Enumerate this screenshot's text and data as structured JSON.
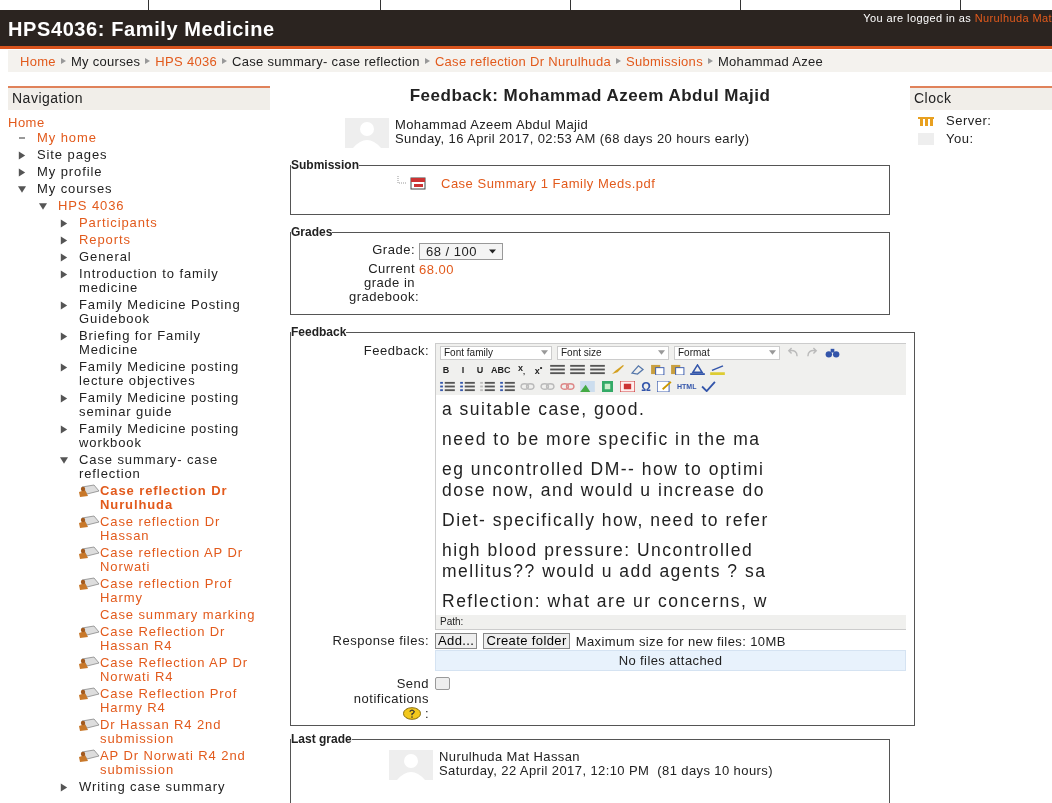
{
  "header": {
    "title": "HPS4036: Family Medicine",
    "login_text": "You are logged in as",
    "login_user": "Nurulhuda Mat"
  },
  "breadcrumb": [
    {
      "label": "Home",
      "link": true
    },
    {
      "label": "My courses",
      "link": false
    },
    {
      "label": "HPS 4036",
      "link": true
    },
    {
      "label": "Case summary- case reflection",
      "link": false
    },
    {
      "label": "Case reflection Dr Nurulhuda",
      "link": true
    },
    {
      "label": "Submissions",
      "link": true
    },
    {
      "label": "Mohammad Azee",
      "link": false
    }
  ],
  "navigation": {
    "title": "Navigation",
    "home": "Home",
    "items": [
      {
        "label": "My home",
        "kind": "home",
        "link": true
      },
      {
        "label": "Site pages",
        "kind": "branch",
        "expanded": false,
        "link": false
      },
      {
        "label": "My profile",
        "kind": "branch",
        "expanded": false,
        "link": false
      },
      {
        "label": "My courses",
        "kind": "branch",
        "expanded": true,
        "link": false,
        "children": [
          {
            "label": "HPS 4036",
            "kind": "branch",
            "expanded": true,
            "link": true,
            "children": [
              {
                "label": "Participants",
                "kind": "branch",
                "expanded": false,
                "link": true
              },
              {
                "label": "Reports",
                "kind": "branch",
                "expanded": false,
                "link": true
              },
              {
                "label": "General",
                "kind": "branch",
                "expanded": false,
                "link": false
              },
              {
                "label": "Introduction to family medicine",
                "kind": "branch",
                "expanded": false,
                "link": false
              },
              {
                "label": "Family Medicine Posting Guidebook",
                "kind": "branch",
                "expanded": false,
                "link": false
              },
              {
                "label": "Briefing for Family Medicine",
                "kind": "branch",
                "expanded": false,
                "link": false
              },
              {
                "label": "Family Medicine posting lecture objectives",
                "kind": "branch",
                "expanded": false,
                "link": false
              },
              {
                "label": "Family Medicine posting seminar guide",
                "kind": "branch",
                "expanded": false,
                "link": false
              },
              {
                "label": "Family Medicine posting workbook",
                "kind": "branch",
                "expanded": false,
                "link": false
              },
              {
                "label": "Case summary- case reflection",
                "kind": "branch",
                "expanded": true,
                "link": false,
                "children": [
                  {
                    "label": "Case reflection Dr Nurulhuda",
                    "kind": "activity",
                    "link": true,
                    "selected": true
                  },
                  {
                    "label": "Case reflection Dr Hassan",
                    "kind": "activity",
                    "link": true,
                    "selected": false
                  },
                  {
                    "label": "Case reflection AP Dr Norwati",
                    "kind": "activity",
                    "link": true,
                    "selected": false
                  },
                  {
                    "label": "Case reflection Prof Harmy",
                    "kind": "activity",
                    "link": true,
                    "selected": false
                  },
                  {
                    "label": "Case summary marking",
                    "kind": "plain",
                    "link": true,
                    "selected": false
                  },
                  {
                    "label": "Case Reflection Dr Hassan R4",
                    "kind": "activity",
                    "link": true,
                    "selected": false
                  },
                  {
                    "label": "Case Reflection AP Dr Norwati R4",
                    "kind": "activity",
                    "link": true,
                    "selected": false
                  },
                  {
                    "label": "Case Reflection Prof Harmy R4",
                    "kind": "activity",
                    "link": true,
                    "selected": false
                  },
                  {
                    "label": "Dr Hassan R4 2nd submission",
                    "kind": "activity",
                    "link": true,
                    "selected": false
                  },
                  {
                    "label": "AP Dr Norwati R4 2nd submission",
                    "kind": "activity",
                    "link": true,
                    "selected": false
                  }
                ]
              },
              {
                "label": "Writing case summary",
                "kind": "branch",
                "expanded": false,
                "link": false
              }
            ]
          }
        ]
      }
    ]
  },
  "main": {
    "title": "Feedback: Mohammad Azeem Abdul Majid",
    "author": {
      "name": "Mohammad Azeem Abdul Majid",
      "date": "Sunday, 16 April 2017, 02:53 AM (68 days 20 hours early)"
    },
    "submission": {
      "legend": "Submission",
      "file": "Case Summary 1 Family Meds.pdf"
    },
    "grades": {
      "legend": "Grades",
      "grade_label": "Grade:",
      "grade_value": "68 / 100",
      "current_label": "Current grade in gradebook:",
      "current_value": "68.00"
    },
    "feedback": {
      "legend": "Feedback",
      "label": "Feedback:",
      "selects": [
        "Font family",
        "Font size",
        "Format"
      ],
      "format_buttons": [
        "B",
        "I",
        "U",
        "ABC",
        "x$_{,}$",
        "x$^{•}$"
      ],
      "insert_buttons": [
        "Ω",
        "HTML"
      ],
      "paragraphs": [
        [
          "a suitable case, good."
        ],
        [
          "need to be more specific in the ma"
        ],
        [
          "eg uncontrolled DM-- how to optimi",
          "dose now, and would u increase do"
        ],
        [
          "Diet- specifically how, need to refer"
        ],
        [
          "high blood pressure: Uncontrolled",
          "mellitus?? would u add agents ? sa"
        ],
        [
          "Reflection: what are ur concerns, w"
        ]
      ],
      "path_label": "Path:",
      "response_label": "Response files:",
      "add_button": "Add...",
      "create_button": "Create folder",
      "max_size": "Maximum size for new files: 10MB",
      "no_files": "No files attached",
      "send_label": "Send notifications",
      "send_suffix": ":",
      "send_checked": false
    },
    "last_grade": {
      "legend": "Last grade",
      "name": "Nurulhuda Mat Hassan",
      "date": "Saturday, 22 April 2017, 12:10 PM  (81 days 10 hours)"
    }
  },
  "clock": {
    "title": "Clock",
    "items": [
      {
        "label": "Server:",
        "kind": "logo"
      },
      {
        "label": "You:",
        "kind": "blank"
      }
    ]
  }
}
